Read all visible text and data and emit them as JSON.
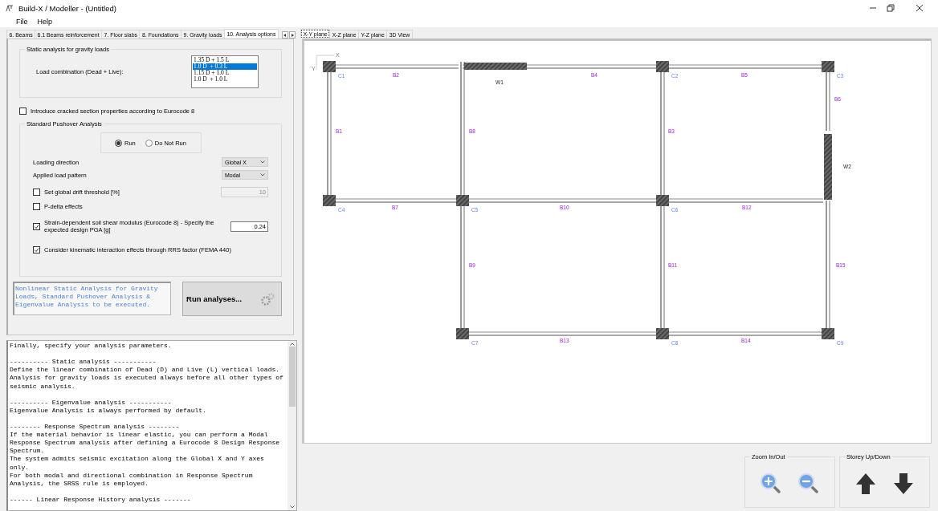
{
  "window": {
    "title": "Build-X / Modeller - (Untitled)"
  },
  "menu": [
    "File",
    "Help"
  ],
  "tabs": [
    {
      "label": "6. Beams",
      "selected": false
    },
    {
      "label": "6.1 Beams reinforcement",
      "selected": false
    },
    {
      "label": "7. Floor slabs",
      "selected": false
    },
    {
      "label": "8. Foundations",
      "selected": false
    },
    {
      "label": "9. Gravity loads",
      "selected": false
    },
    {
      "label": "10. Analysis options",
      "selected": true
    }
  ],
  "static_group": {
    "title": "Static analysis for gravity loads",
    "label": "Load combination (Dead + Live):",
    "options": [
      {
        "label": "1.35 D + 1.5 L",
        "selected": false
      },
      {
        "label": "1.0 D  + 0.3 L",
        "selected": true
      },
      {
        "label": "1.15 D + 1.0 L",
        "selected": false
      },
      {
        "label": "1.0 D  + 1.0 L",
        "selected": false
      }
    ]
  },
  "cracked": {
    "label": "Introduce cracked section properties according to Eurocode 8",
    "checked": false
  },
  "pushover": {
    "title": "Standard Pushover Analysis",
    "run_options": [
      {
        "label": "Run",
        "selected": true
      },
      {
        "label": "Do Not Run",
        "selected": false
      }
    ],
    "loading_direction": {
      "label": "Loading direction",
      "value": "Global X"
    },
    "load_pattern": {
      "label": "Applied load pattern",
      "value": "Modal"
    },
    "drift": {
      "label": "Set global drift threshold [%]",
      "checked": false,
      "value": "10"
    },
    "pdelta": {
      "label": "P-delta effects",
      "checked": false
    },
    "soil": {
      "label": "Strain-dependent soil shear modulus (Eurocode 8) - Specify the expected design PGA [g]",
      "checked": true,
      "value": "0.24"
    },
    "kinematic": {
      "label": "Consider kinematic interaction effects through RRS factor (FEMA 440)",
      "checked": true
    }
  },
  "summary": "Nonlinear Static Analysis for Gravity\nLoads, Standard Pushover Analysis &\nEigenvalue Analysis to be executed.",
  "run_button": "Run analyses...",
  "console": {
    "paragraphs": [
      "Finally, specify your analysis parameters.",
      "---------- Static analysis -----------\nDefine the linear combination of Dead (D) and Live (L) vertical loads.\nAnalysis for gravity loads is executed always before all other types of\nseismic analysis.",
      "---------- Eigenvalue analysis -----------\nEigenvalue Analysis is always performed by default.",
      "-------- Response Spectrum analysis --------\nIf the material behavior is linear elastic, you can perform a Modal\nResponse Spectrum analysis after defining a Eurocode 8 Design Response\nSpectrum.\nThe system admits seismic excitation along the Global X and Y axes\nonly.\nFor both modal and directional combination in Response Spectrum\nAnalysis, the SRSS rule is employed.",
      "------ Linear Response History analysis -------"
    ]
  },
  "view_tabs": [
    {
      "label": "X-Y plane",
      "selected": true
    },
    {
      "label": "X-Z plane",
      "selected": false
    },
    {
      "label": "Y-Z plane",
      "selected": false
    },
    {
      "label": "3D View",
      "selected": false
    }
  ],
  "plan": {
    "axis_labels": [
      "X",
      "Y"
    ],
    "columns": [
      {
        "label": "C1"
      },
      {
        "label": "C2"
      },
      {
        "label": "C3"
      },
      {
        "label": "C4"
      },
      {
        "label": "C5"
      },
      {
        "label": "C6"
      },
      {
        "label": "C7"
      },
      {
        "label": "C8"
      },
      {
        "label": "C9"
      }
    ],
    "beams": [
      {
        "label": "B1"
      },
      {
        "label": "B2"
      },
      {
        "label": "B3"
      },
      {
        "label": "B4"
      },
      {
        "label": "B5"
      },
      {
        "label": "B6"
      },
      {
        "label": "B7"
      },
      {
        "label": "B8"
      },
      {
        "label": "B9"
      },
      {
        "label": "B10"
      },
      {
        "label": "B11"
      },
      {
        "label": "B12"
      },
      {
        "label": "B13"
      },
      {
        "label": "B14"
      },
      {
        "label": "B15"
      }
    ],
    "walls": [
      {
        "label": "W1"
      },
      {
        "label": "W2"
      }
    ]
  },
  "zoom_group": {
    "title": "Zoom In/Out"
  },
  "storey_group": {
    "title": "Storey Up/Down"
  }
}
